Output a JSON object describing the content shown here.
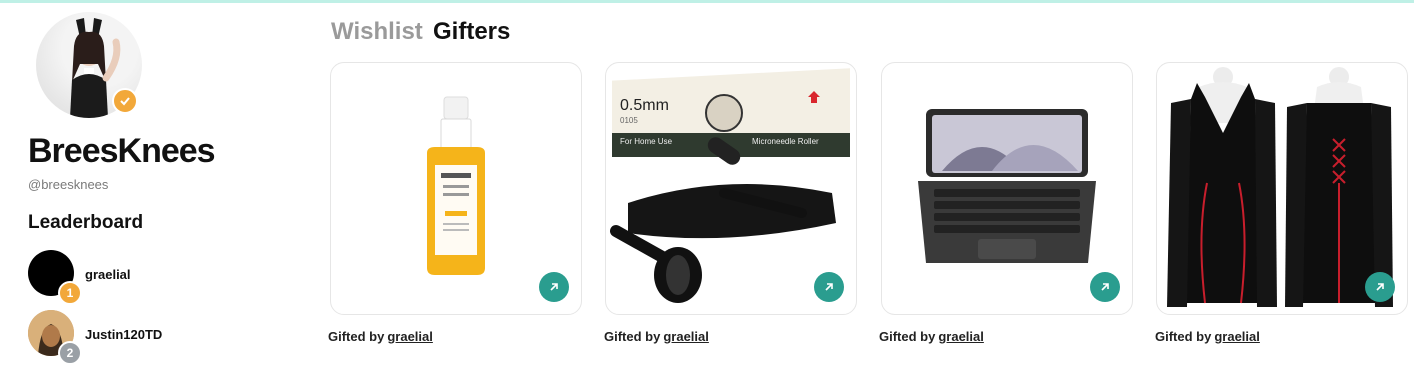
{
  "profile": {
    "display_name": "BreesKnees",
    "handle": "@breesknees",
    "verified_badge_color": "#f2a83a"
  },
  "leaderboard": {
    "title": "Leaderboard",
    "entries": [
      {
        "name": "graelial",
        "rank": "1"
      },
      {
        "name": "Justin120TD",
        "rank": "2"
      }
    ]
  },
  "tabs": [
    {
      "label": "Wishlist",
      "active": false
    },
    {
      "label": "Gifters",
      "active": true
    }
  ],
  "gifts": [
    {
      "product_icon": "serum-bottle",
      "gifted_label": "Gifted by",
      "gifter": "graelial",
      "box_text_size": "0.5mm",
      "box_text_code": "0105",
      "box_text_left": "For Home Use",
      "box_text_right": "Microneedle Roller"
    },
    {
      "product_icon": "derma-roller",
      "gifted_label": "Gifted by",
      "gifter": "graelial"
    },
    {
      "product_icon": "ipad-keyboard",
      "gifted_label": "Gifted by",
      "gifter": "graelial"
    },
    {
      "product_icon": "corset-dress",
      "gifted_label": "Gifted by",
      "gifter": "graelial"
    }
  ],
  "colors": {
    "accent": "#2a9d8f",
    "top_bar": "#bff0e6",
    "inactive_tab": "#9a9a9a"
  }
}
